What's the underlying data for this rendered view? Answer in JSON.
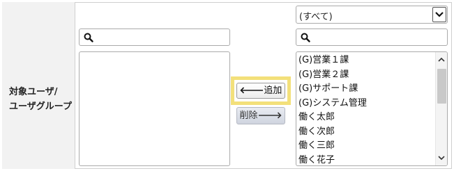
{
  "label": {
    "line1": "対象ユーザ/",
    "line2": "ユーザグループ"
  },
  "left_panel": {
    "search": {
      "value": "",
      "placeholder": "",
      "icon": "search-icon"
    },
    "selected_items": []
  },
  "buttons": {
    "add": {
      "label": "追加",
      "icon": "arrow-left-icon",
      "arrow": "🡐"
    },
    "remove": {
      "label": "削除",
      "icon": "arrow-right-icon",
      "arrow": "🡒"
    }
  },
  "right_panel": {
    "filter": {
      "selected": "(すべて)"
    },
    "search": {
      "value": "",
      "placeholder": "",
      "icon": "search-icon"
    },
    "items": [
      "(G)営業１課",
      "(G)営業２課",
      "(G)サポート課",
      "(G)システム管理",
      "働く太郎",
      "働く次郎",
      "働く三郎",
      "働く花子"
    ]
  },
  "colors": {
    "label_bg": "#f2f2f2",
    "border": "#cfcfcf",
    "highlight": "#f3e07a",
    "remove_button_bg": "#d6dae3"
  }
}
